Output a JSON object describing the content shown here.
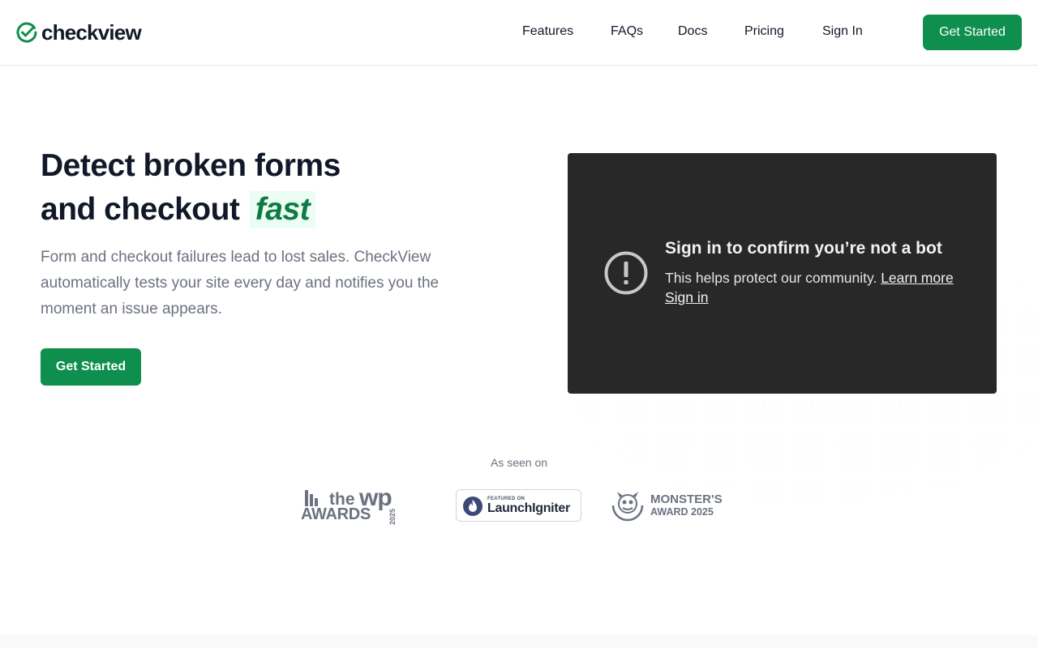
{
  "header": {
    "logo_text": "checkview",
    "nav": [
      "Features",
      "FAQs",
      "Docs",
      "Pricing",
      "Sign In"
    ],
    "cta_label": "Get Started"
  },
  "hero": {
    "title_line1": "Detect broken forms",
    "title_line2": "and checkout",
    "title_highlight": "fast",
    "description": "Form and checkout failures lead to lost sales. CheckView automatically tests your site every day and notifies you the moment an issue appears.",
    "cta_label": "Get Started"
  },
  "video": {
    "title": "Sign in to confirm you’re not a bot",
    "body": "This helps protect our community.",
    "learn_more": "Learn more",
    "sign_in": "Sign in"
  },
  "seen_on": {
    "label": "As seen on",
    "wp_award_the": "the",
    "wp_award_wp": "WP",
    "wp_award_awards": "AWARDS",
    "wp_award_year": "2025",
    "launchigniter_featured": "FEATURED ON",
    "launchigniter_name": "LaunchIgniter",
    "monster_line1": "MONSTER'S",
    "monster_line2": "AWARD 2025"
  },
  "colors": {
    "brand_green": "#0e8f4e",
    "highlight_bg": "#ecfdf3",
    "video_bg": "#282828"
  },
  "icons": {
    "logo": "check-circle-icon",
    "video_warning": "exclamation-circle-icon",
    "launchigniter": "flame-icon"
  }
}
